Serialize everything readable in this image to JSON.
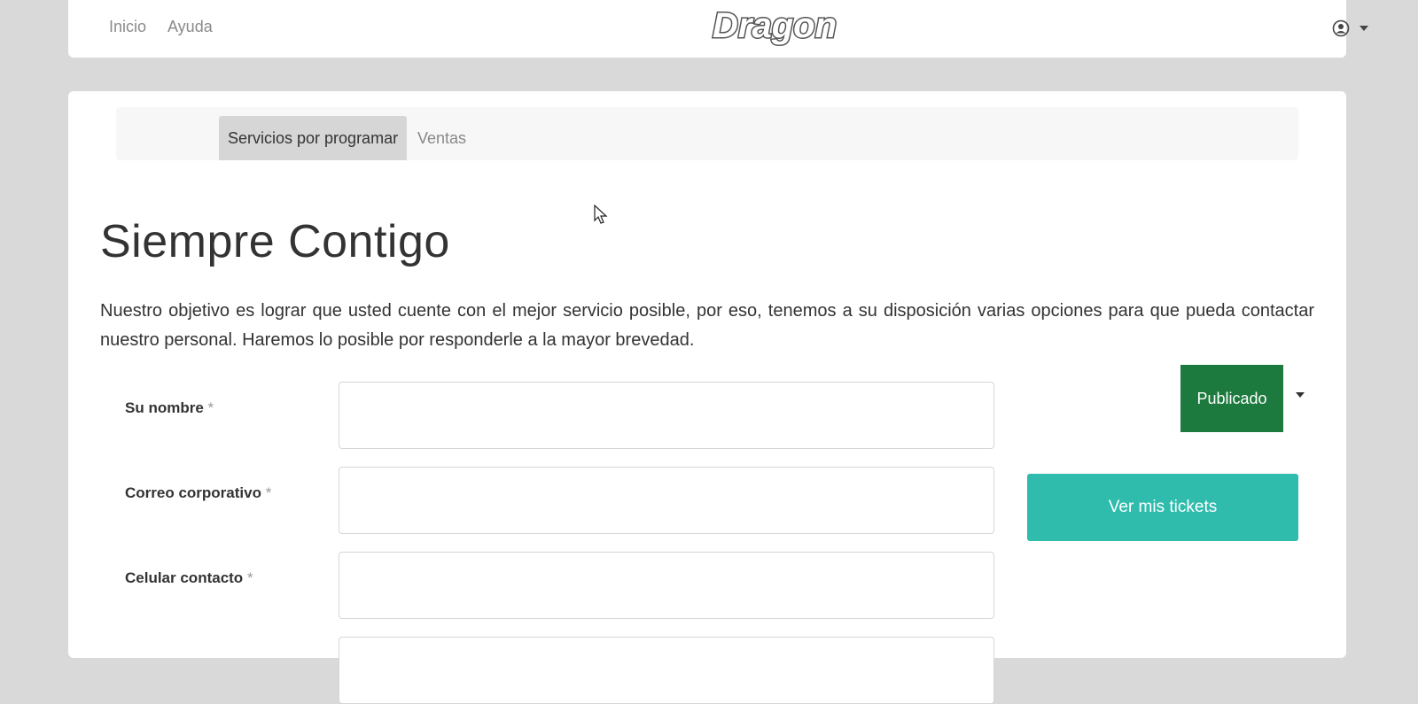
{
  "header": {
    "nav": [
      {
        "label": "Inicio"
      },
      {
        "label": "Ayuda"
      }
    ],
    "logo_text": "Dragon",
    "user_icon": "user-circle-icon",
    "dropdown_icon": "caret-down-icon"
  },
  "tabs": [
    {
      "label": "Servicios por programar",
      "active": true
    },
    {
      "label": "Ventas",
      "active": false
    }
  ],
  "main": {
    "title": "Siempre Contigo",
    "intro": "Nuestro objetivo es lograr que usted cuente con el mejor servicio posible, por eso, tenemos a su disposición varias opciones para que pueda contactar nuestro personal. Haremos lo posible por responderle a la mayor brevedad.",
    "required_mark": "*"
  },
  "form": {
    "fields": [
      {
        "label": "Su nombre",
        "value": ""
      },
      {
        "label": "Correo corporativo",
        "value": ""
      },
      {
        "label": "Celular contacto",
        "value": ""
      }
    ]
  },
  "actions": {
    "publicado_label": "Publicado",
    "tickets_label": "Ver mis tickets"
  },
  "colors": {
    "background": "#d9d9da",
    "publicado": "#1d7a3e",
    "tickets": "#2fbcad"
  }
}
